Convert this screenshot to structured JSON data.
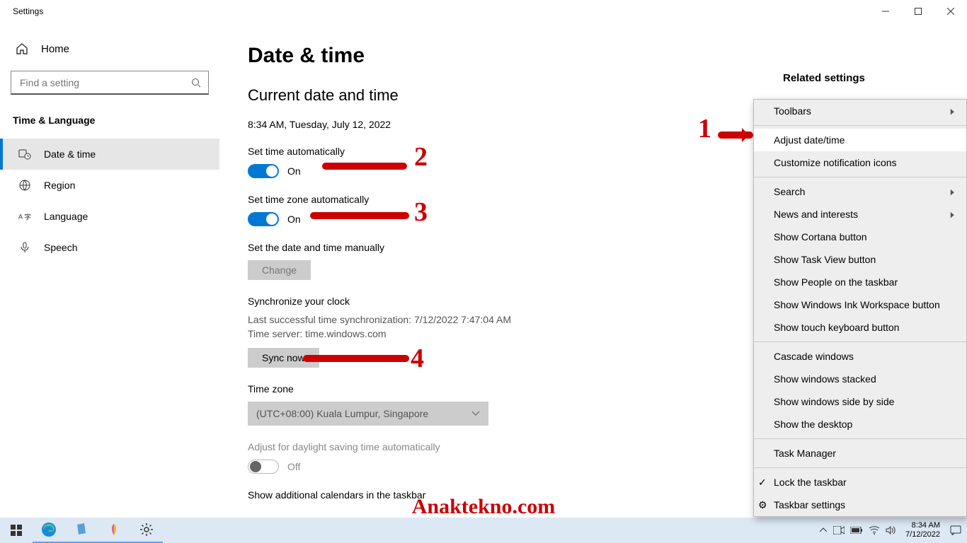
{
  "window": {
    "title": "Settings"
  },
  "sidebar": {
    "home": "Home",
    "search_placeholder": "Find a setting",
    "category": "Time & Language",
    "items": [
      {
        "label": "Date & time"
      },
      {
        "label": "Region"
      },
      {
        "label": "Language"
      },
      {
        "label": "Speech"
      }
    ]
  },
  "page": {
    "title": "Date & time",
    "current_heading": "Current date and time",
    "current_value": "8:34 AM, Tuesday, July 12, 2022",
    "set_time_auto": {
      "label": "Set time automatically",
      "state": "On"
    },
    "set_tz_auto": {
      "label": "Set time zone automatically",
      "state": "On"
    },
    "manual": {
      "label": "Set the date and time manually",
      "button": "Change"
    },
    "sync": {
      "heading": "Synchronize your clock",
      "last": "Last successful time synchronization: 7/12/2022 7:47:04 AM",
      "server": "Time server: time.windows.com",
      "button": "Sync now"
    },
    "tz": {
      "label": "Time zone",
      "value": "(UTC+08:00) Kuala Lumpur, Singapore"
    },
    "dst": {
      "label": "Adjust for daylight saving time automatically",
      "state": "Off"
    },
    "additional": "Show additional calendars in the taskbar"
  },
  "aside": {
    "heading": "Related settings"
  },
  "context": {
    "toolbars": "Toolbars",
    "adjust": "Adjust date/time",
    "customize": "Customize notification icons",
    "search": "Search",
    "news": "News and interests",
    "cortana": "Show Cortana button",
    "taskview": "Show Task View button",
    "people": "Show People on the taskbar",
    "ink": "Show Windows Ink Workspace button",
    "touchkb": "Show touch keyboard button",
    "cascade": "Cascade windows",
    "stacked": "Show windows stacked",
    "sideby": "Show windows side by side",
    "desktop": "Show the desktop",
    "taskmgr": "Task Manager",
    "lock": "Lock the taskbar",
    "tbsettings": "Taskbar settings"
  },
  "taskbar": {
    "time": "8:34 AM",
    "date": "7/12/2022"
  },
  "annotations": {
    "n1": "1",
    "n2": "2",
    "n3": "3",
    "n4": "4"
  },
  "watermark": "Anaktekno.com"
}
